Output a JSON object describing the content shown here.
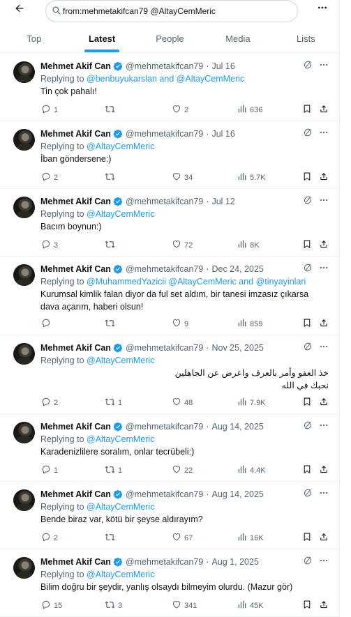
{
  "search": {
    "query": "from:mehmetakifcan79 @AltayCemMeric"
  },
  "tabs": [
    {
      "label": "Top"
    },
    {
      "label": "Latest",
      "active": true
    },
    {
      "label": "People"
    },
    {
      "label": "Media"
    },
    {
      "label": "Lists"
    }
  ],
  "colors": {
    "accent": "#1d9bf0",
    "muted": "#536471",
    "text": "#0f1419",
    "border": "#eff3f4"
  },
  "icons": [
    "back-arrow-icon",
    "search-icon",
    "more-icon",
    "grok-icon",
    "reply-icon",
    "repost-icon",
    "like-icon",
    "views-icon",
    "bookmark-icon",
    "share-icon",
    "verified-badge-icon"
  ],
  "tweets": [
    {
      "name": "Mehmet Akif Can",
      "handle": "@mehmetakifcan79",
      "date": "Jul 16",
      "replying_prefix": "Replying to ",
      "replying_to": "@benbuyukarslan and @AltayCemMeric",
      "text": "Tin çok pahalı!",
      "rtl": false,
      "replies": "1",
      "reposts": "",
      "likes": "2",
      "views": "636"
    },
    {
      "name": "Mehmet Akif Can",
      "handle": "@mehmetakifcan79",
      "date": "Jul 16",
      "replying_prefix": "Replying to ",
      "replying_to": "@AltayCemMeric",
      "text": "İban göndersene:)",
      "rtl": false,
      "replies": "2",
      "reposts": "",
      "likes": "34",
      "views": "5.7K"
    },
    {
      "name": "Mehmet Akif Can",
      "handle": "@mehmetakifcan79",
      "date": "Jul 12",
      "replying_prefix": "Replying to ",
      "replying_to": "@AltayCemMeric",
      "text": "Bacım boynun:)",
      "rtl": false,
      "replies": "3",
      "reposts": "",
      "likes": "72",
      "views": "8K"
    },
    {
      "name": "Mehmet Akif Can",
      "handle": "@mehmetakifcan79",
      "date": "Dec 24, 2025",
      "replying_prefix": "Replying to ",
      "replying_to": "@MuhammedYazicii @AltayCemMeric and @tinyayinlari",
      "text": "Kurumsal kimlik falan diyor da ful set aldım, bir tanesi imzasız çıkarsa dava açarım, haberi olsun!",
      "rtl": false,
      "replies": "",
      "reposts": "",
      "likes": "9",
      "views": "859"
    },
    {
      "name": "Mehmet Akif Can",
      "handle": "@mehmetakifcan79",
      "date": "Nov 25, 2025",
      "replying_prefix": "Replying to ",
      "replying_to": "@AltayCemMeric",
      "text": "خذ العفو وأمر بالعرف واعرض عن الجاهلين\nنحبك في الله",
      "rtl": true,
      "replies": "2",
      "reposts": "1",
      "likes": "48",
      "views": "7.9K"
    },
    {
      "name": "Mehmet Akif Can",
      "handle": "@mehmetakifcan79",
      "date": "Aug 14, 2025",
      "replying_prefix": "Replying to ",
      "replying_to": "@AltayCemMeric",
      "text": "Karadenizlilere soralım, onlar tecrübeli:)",
      "rtl": false,
      "replies": "1",
      "reposts": "1",
      "likes": "22",
      "views": "4.4K"
    },
    {
      "name": "Mehmet Akif Can",
      "handle": "@mehmetakifcan79",
      "date": "Aug 14, 2025",
      "replying_prefix": "Replying to ",
      "replying_to": "@AltayCemMeric",
      "text": "Bende biraz var, kötü bir şeyse aldırayım?",
      "rtl": false,
      "replies": "2",
      "reposts": "",
      "likes": "67",
      "views": "16K"
    },
    {
      "name": "Mehmet Akif Can",
      "handle": "@mehmetakifcan79",
      "date": "Aug 1, 2025",
      "replying_prefix": "Replying to ",
      "replying_to": "@AltayCemMeric",
      "text": "Bilim doğru bir şeydir, yanlış olsaydı bilmeyim olurdu. (Mazur gör)",
      "rtl": false,
      "replies": "15",
      "reposts": "3",
      "likes": "341",
      "views": "45K"
    }
  ]
}
